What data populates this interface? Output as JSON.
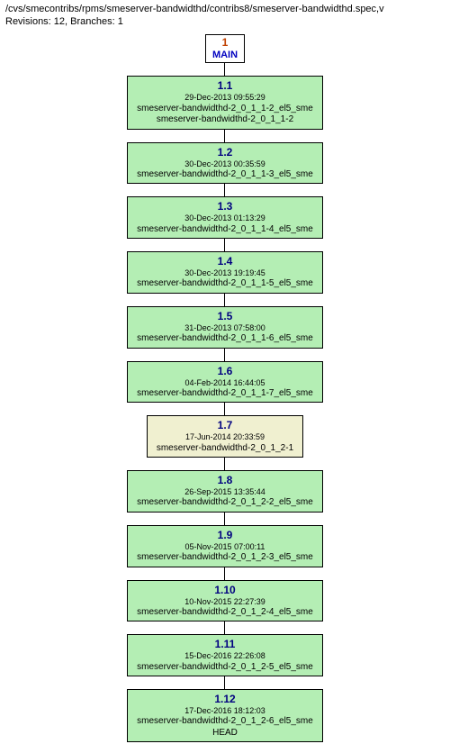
{
  "header": {
    "path": "/cvs/smecontribs/rpms/smeserver-bandwidthd/contribs8/smeserver-bandwidthd.spec,v",
    "revisions_label": "Revisions: 12, Branches: 1"
  },
  "branch_root": {
    "number": "1",
    "name": "MAIN"
  },
  "nodes": [
    {
      "version": "1.1",
      "date": "29-Dec-2013 09:55:29",
      "tags": [
        "smeserver-bandwidthd-2_0_1_1-2_el5_sme",
        "smeserver-bandwidthd-2_0_1_1-2"
      ],
      "alt": false
    },
    {
      "version": "1.2",
      "date": "30-Dec-2013 00:35:59",
      "tags": [
        "smeserver-bandwidthd-2_0_1_1-3_el5_sme"
      ],
      "alt": false
    },
    {
      "version": "1.3",
      "date": "30-Dec-2013 01:13:29",
      "tags": [
        "smeserver-bandwidthd-2_0_1_1-4_el5_sme"
      ],
      "alt": false
    },
    {
      "version": "1.4",
      "date": "30-Dec-2013 19:19:45",
      "tags": [
        "smeserver-bandwidthd-2_0_1_1-5_el5_sme"
      ],
      "alt": false
    },
    {
      "version": "1.5",
      "date": "31-Dec-2013 07:58:00",
      "tags": [
        "smeserver-bandwidthd-2_0_1_1-6_el5_sme"
      ],
      "alt": false
    },
    {
      "version": "1.6",
      "date": "04-Feb-2014 16:44:05",
      "tags": [
        "smeserver-bandwidthd-2_0_1_1-7_el5_sme"
      ],
      "alt": false
    },
    {
      "version": "1.7",
      "date": "17-Jun-2014 20:33:59",
      "tags": [
        "smeserver-bandwidthd-2_0_1_2-1"
      ],
      "alt": true
    },
    {
      "version": "1.8",
      "date": "26-Sep-2015 13:35:44",
      "tags": [
        "smeserver-bandwidthd-2_0_1_2-2_el5_sme"
      ],
      "alt": false
    },
    {
      "version": "1.9",
      "date": "05-Nov-2015 07:00:11",
      "tags": [
        "smeserver-bandwidthd-2_0_1_2-3_el5_sme"
      ],
      "alt": false
    },
    {
      "version": "1.10",
      "date": "10-Nov-2015 22:27:39",
      "tags": [
        "smeserver-bandwidthd-2_0_1_2-4_el5_sme"
      ],
      "alt": false
    },
    {
      "version": "1.11",
      "date": "15-Dec-2016 22:26:08",
      "tags": [
        "smeserver-bandwidthd-2_0_1_2-5_el5_sme"
      ],
      "alt": false
    },
    {
      "version": "1.12",
      "date": "17-Dec-2016 18:12:03",
      "tags": [
        "smeserver-bandwidthd-2_0_1_2-6_el5_sme",
        "HEAD"
      ],
      "alt": false
    }
  ]
}
